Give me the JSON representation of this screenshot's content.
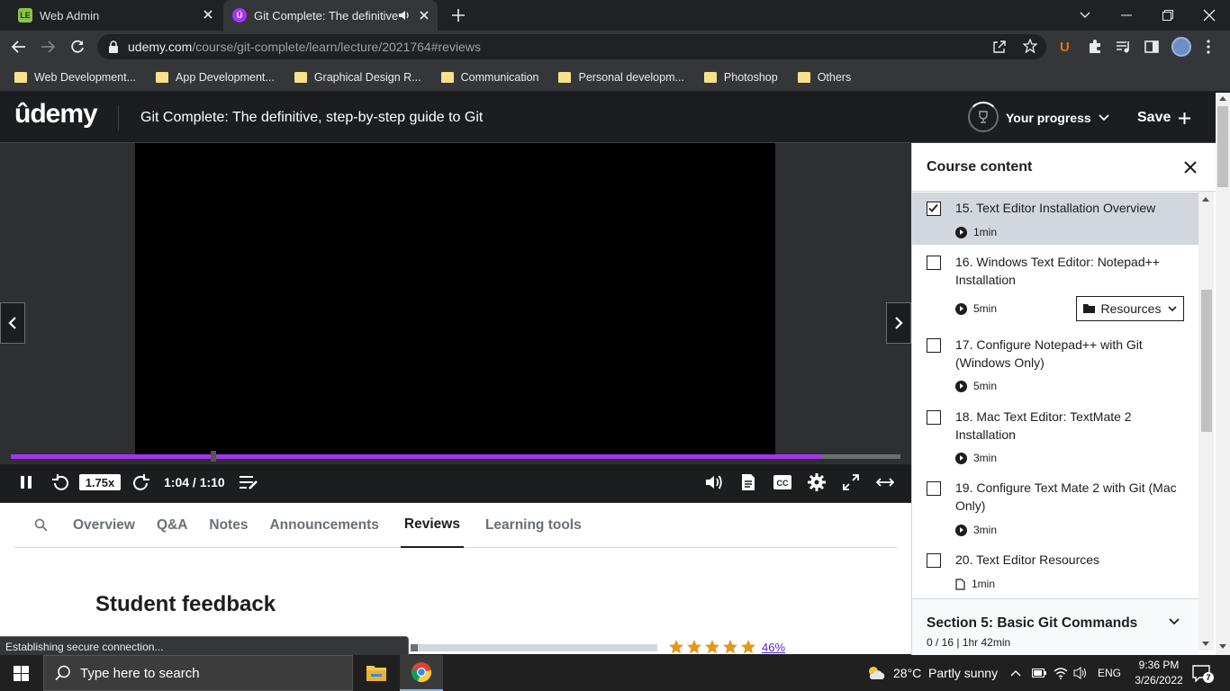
{
  "browser": {
    "tabs": [
      {
        "title": "Web Admin",
        "favicon_text": "LE",
        "favicon_color": "#8bc34a"
      },
      {
        "title": "Git Complete: The definitive,",
        "favicon_text": "Ú",
        "favicon_color": "#a435f0"
      }
    ],
    "url": {
      "host": "udemy.com",
      "path": "/course/git-complete/learn/lecture/2021764#reviews"
    },
    "bookmarks": [
      "Web Development...",
      "App Development...",
      "Graphical Design R...",
      "Communication",
      "Personal developm...",
      "Photoshop",
      "Others"
    ],
    "extension_label": "U"
  },
  "header": {
    "logo": "ûdemy",
    "course_title": "Git Complete: The definitive, step-by-step guide to Git",
    "progress_label": "Your progress",
    "save_label": "Save"
  },
  "player": {
    "speed": "1.75x",
    "time": "1:04 / 1:10",
    "progress_fraction": 0.911,
    "buffer_knob_fraction": 0.225,
    "accent": "#a435f0"
  },
  "content_tabs": [
    "Overview",
    "Q&A",
    "Notes",
    "Announcements",
    "Reviews",
    "Learning tools"
  ],
  "active_tab": "Reviews",
  "feedback": {
    "title": "Student feedback",
    "first_row_percent": "46%",
    "first_row_fraction": 0.03,
    "stars": 5
  },
  "status_text": "Establishing secure connection...",
  "sidebar": {
    "title": "Course content",
    "lectures": [
      {
        "title": "15. Text Editor Installation Overview",
        "duration": "1min",
        "checked": true,
        "type": "video"
      },
      {
        "title": "16. Windows Text Editor: Notepad++ Installation",
        "duration": "5min",
        "checked": false,
        "type": "video",
        "resources": "Resources"
      },
      {
        "title": "17. Configure Notepad++ with Git (Windows Only)",
        "duration": "5min",
        "checked": false,
        "type": "video"
      },
      {
        "title": "18. Mac Text Editor: TextMate 2 Installation",
        "duration": "3min",
        "checked": false,
        "type": "video"
      },
      {
        "title": "19. Configure Text Mate 2 with Git (Mac Only)",
        "duration": "3min",
        "checked": false,
        "type": "video"
      },
      {
        "title": "20. Text Editor Resources",
        "duration": "1min",
        "checked": false,
        "type": "article"
      }
    ],
    "section": {
      "title": "Section 5: Basic Git Commands",
      "meta": "0 / 16 | 1hr 42min"
    }
  },
  "taskbar": {
    "search_placeholder": "Type here to search",
    "weather": "28°C  Partly sunny",
    "language": "ENG",
    "time": "9:36 PM",
    "date": "3/26/2022",
    "notification_count": "7"
  }
}
